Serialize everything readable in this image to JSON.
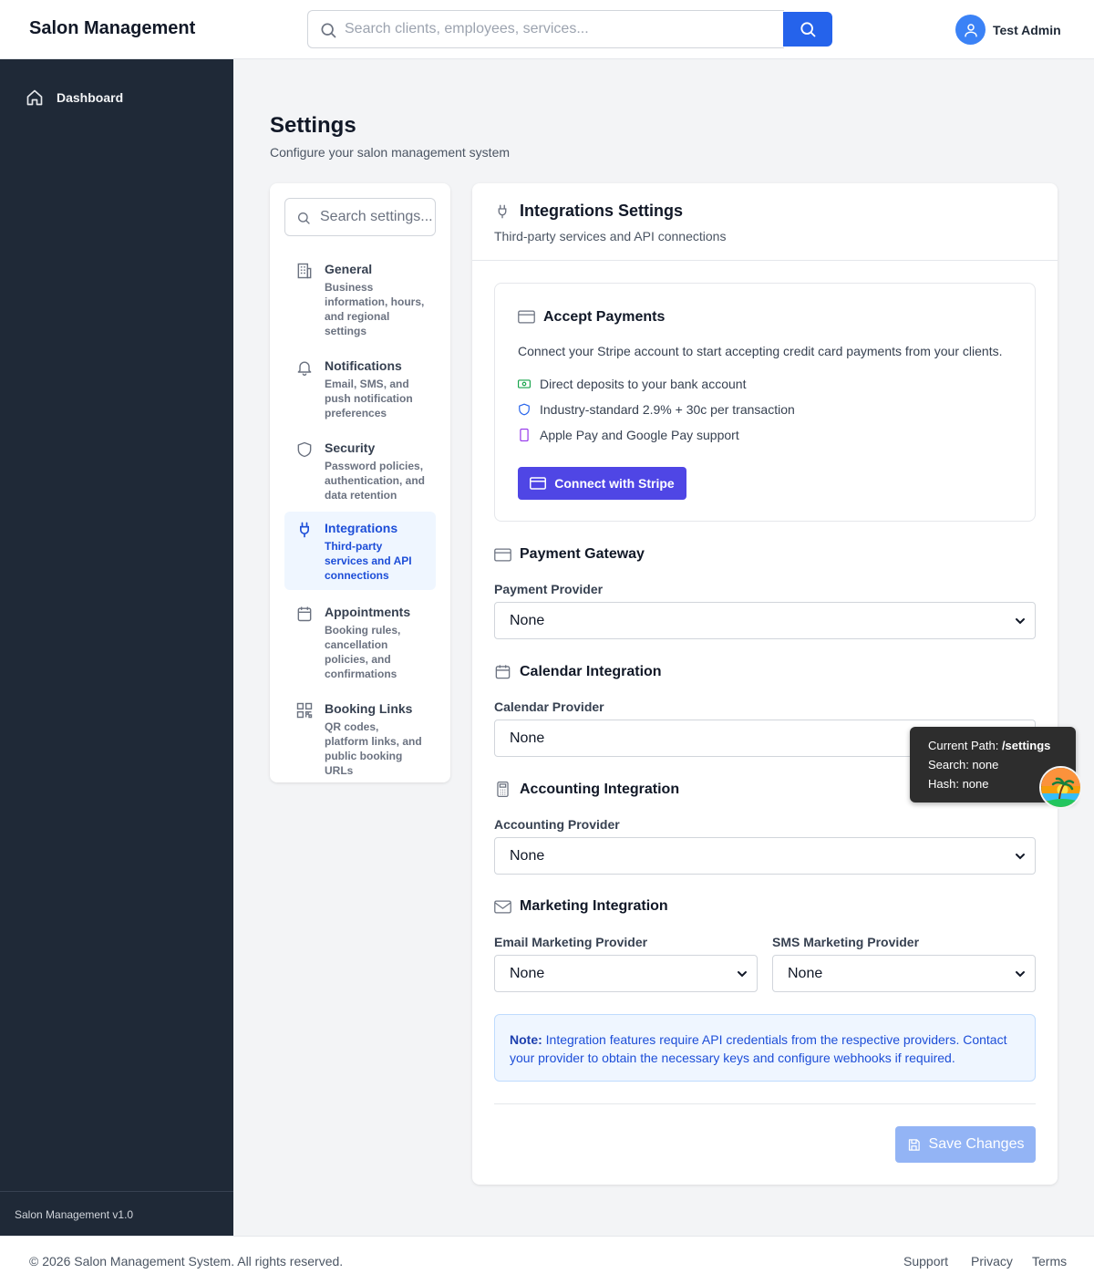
{
  "header": {
    "app_title": "Salon Management",
    "search_placeholder": "Search clients, employees, services...",
    "user_name": "Test Admin"
  },
  "sidebar": {
    "items": [
      {
        "label": "Dashboard",
        "icon": "home-icon"
      }
    ],
    "footer": "Salon Management v1.0"
  },
  "page": {
    "title": "Settings",
    "subtitle": "Configure your salon management system"
  },
  "settings_nav": {
    "search_placeholder": "Search settings...",
    "items": [
      {
        "label": "General",
        "desc": "Business information, hours, and regional settings",
        "icon": "building-icon"
      },
      {
        "label": "Notifications",
        "desc": "Email, SMS, and push notification preferences",
        "icon": "bell-icon"
      },
      {
        "label": "Security",
        "desc": "Password policies, authentication, and data retention",
        "icon": "shield-icon"
      },
      {
        "label": "Integrations",
        "desc": "Third-party services and API connections",
        "icon": "plug-icon",
        "active": true
      },
      {
        "label": "Appointments",
        "desc": "Booking rules, cancellation policies, and confirmations",
        "icon": "calendar-icon"
      },
      {
        "label": "Booking Links",
        "desc": "QR codes, platform links, and public booking URLs",
        "icon": "qr-code-icon"
      }
    ]
  },
  "panel": {
    "title": "Integrations Settings",
    "subtitle": "Third-party services and API connections",
    "stripe": {
      "title": "Accept Payments",
      "description": "Connect your Stripe account to start accepting credit card payments from your clients.",
      "features": [
        {
          "text": "Direct deposits to your bank account",
          "icon": "banknote-icon",
          "color": "#16a34a"
        },
        {
          "text": "Industry-standard 2.9% + 30c per transaction",
          "icon": "shield-icon",
          "color": "#2563eb"
        },
        {
          "text": "Apple Pay and Google Pay support",
          "icon": "smartphone-icon",
          "color": "#9333ea"
        }
      ],
      "button": "Connect with Stripe"
    },
    "payment": {
      "title": "Payment Gateway",
      "label": "Payment Provider",
      "value": "None"
    },
    "calendar": {
      "title": "Calendar Integration",
      "label": "Calendar Provider",
      "value": "None"
    },
    "accounting": {
      "title": "Accounting Integration",
      "label": "Accounting Provider",
      "value": "None"
    },
    "marketing": {
      "title": "Marketing Integration",
      "email_label": "Email Marketing Provider",
      "email_value": "None",
      "sms_label": "SMS Marketing Provider",
      "sms_value": "None"
    },
    "note": {
      "prefix": "Note:",
      "text": " Integration features require API credentials from the respective providers. Contact your provider to obtain the necessary keys and configure webhooks if required."
    },
    "save": "Save Changes"
  },
  "debug_tooltip": {
    "path_label": "Current Path: ",
    "path_value": "/settings",
    "search_line": "Search: none",
    "hash_line": "Hash: none"
  },
  "footer": {
    "copyright": "© 2026 Salon Management System. All rights reserved.",
    "links": [
      "Support",
      "Privacy",
      "Terms"
    ]
  },
  "colors": {
    "primary": "#2563eb",
    "stripe": "#4f46e5",
    "sidebar_bg": "#1f2937",
    "active_nav": "#1d4ed8"
  }
}
